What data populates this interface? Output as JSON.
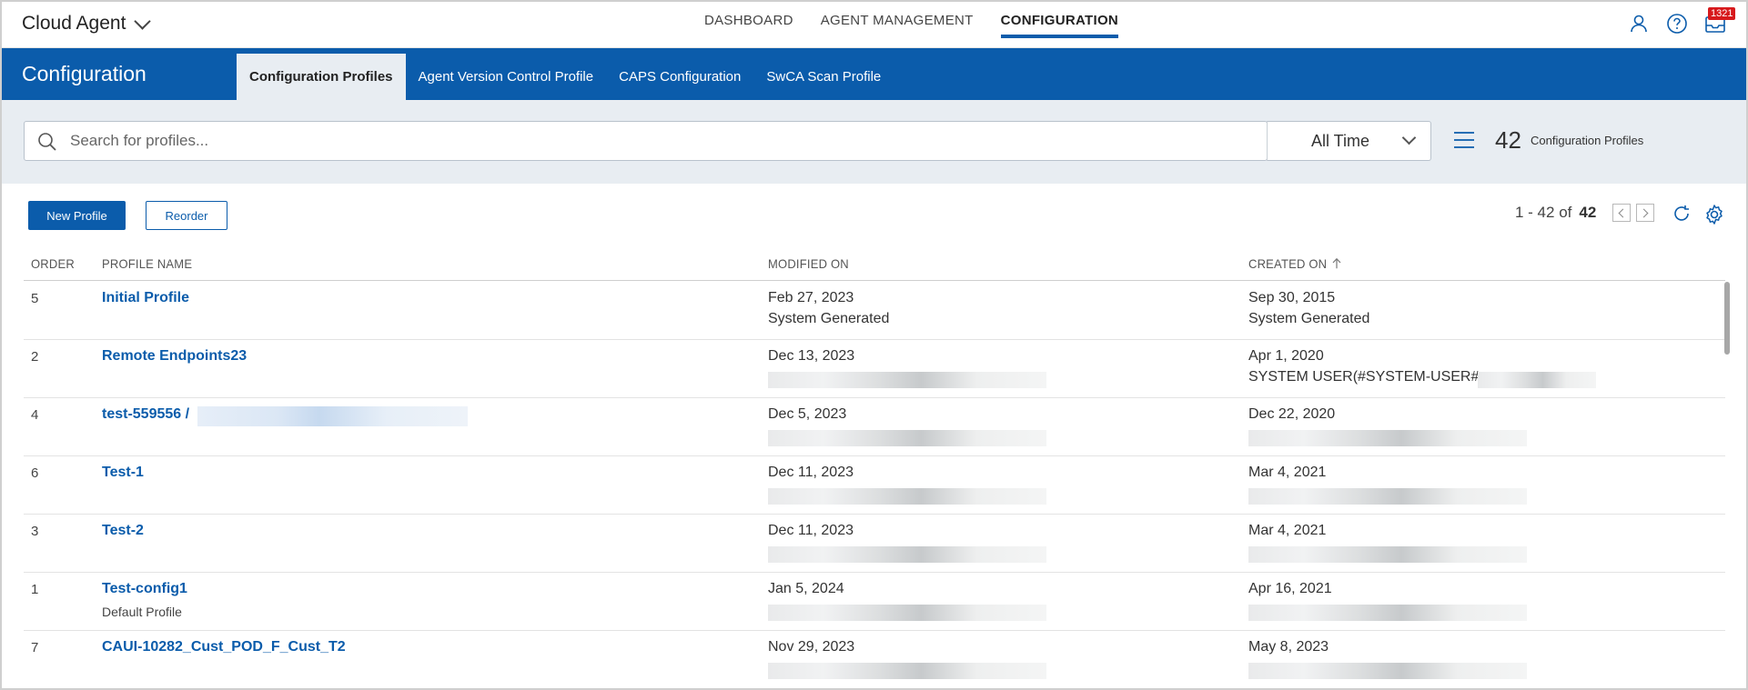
{
  "app": {
    "title": "Cloud Agent"
  },
  "topnav": [
    {
      "label": "DASHBOARD",
      "active": false
    },
    {
      "label": "AGENT MANAGEMENT",
      "active": false
    },
    {
      "label": "CONFIGURATION",
      "active": true
    }
  ],
  "top_icons": {
    "user": "user-icon",
    "help": "help-icon",
    "notifications": "notification-icon",
    "notification_count": "1321"
  },
  "header": {
    "title": "Configuration",
    "tabs": [
      {
        "label": "Configuration Profiles",
        "active": true
      },
      {
        "label": "Agent Version Control Profile",
        "active": false
      },
      {
        "label": "CAPS Configuration",
        "active": false
      },
      {
        "label": "SwCA Scan Profile",
        "active": false
      }
    ]
  },
  "search": {
    "placeholder": "Search for profiles...",
    "value": ""
  },
  "time_filter": {
    "selected": "All Time"
  },
  "summary": {
    "count": "42",
    "label": "Configuration Profiles"
  },
  "toolbar": {
    "new_label": "New Profile",
    "reorder_label": "Reorder"
  },
  "pager": {
    "range": "1 - 42 of",
    "total": "42"
  },
  "table": {
    "columns": {
      "order": "ORDER",
      "name": "PROFILE NAME",
      "modified": "MODIFIED ON",
      "created": "CREATED ON"
    },
    "rows": [
      {
        "order": "5",
        "name": "Initial Profile",
        "sub": "",
        "modified_date": "Feb 27, 2023",
        "modified_by": "System Generated",
        "created_date": "Sep 30, 2015",
        "created_by": "System Generated"
      },
      {
        "order": "2",
        "name": "Remote Endpoints23",
        "sub": "",
        "modified_date": "Dec 13, 2023",
        "modified_by": "",
        "created_date": "Apr 1, 2020",
        "created_by": "SYSTEM USER(#SYSTEM-USER#"
      },
      {
        "order": "4",
        "name": "test-559556 /",
        "sub": "",
        "modified_date": "Dec 5, 2023",
        "modified_by": "",
        "created_date": "Dec 22, 2020",
        "created_by": ""
      },
      {
        "order": "6",
        "name": "Test-1",
        "sub": "",
        "modified_date": "Dec 11, 2023",
        "modified_by": "",
        "created_date": "Mar 4, 2021",
        "created_by": ""
      },
      {
        "order": "3",
        "name": "Test-2",
        "sub": "",
        "modified_date": "Dec 11, 2023",
        "modified_by": "",
        "created_date": "Mar 4, 2021",
        "created_by": ""
      },
      {
        "order": "1",
        "name": "Test-config1",
        "sub": "Default Profile",
        "modified_date": "Jan 5, 2024",
        "modified_by": "",
        "created_date": "Apr 16, 2021",
        "created_by": ""
      },
      {
        "order": "7",
        "name": "CAUI-10282_Cust_POD_F_Cust_T2",
        "sub": "",
        "modified_date": "Nov 29, 2023",
        "modified_by": "",
        "created_date": "May 8, 2023",
        "created_by": ""
      }
    ]
  },
  "colors": {
    "brand_blue": "#0b5cab",
    "band_gray": "#e8edf2",
    "badge_red": "#d7191c"
  }
}
